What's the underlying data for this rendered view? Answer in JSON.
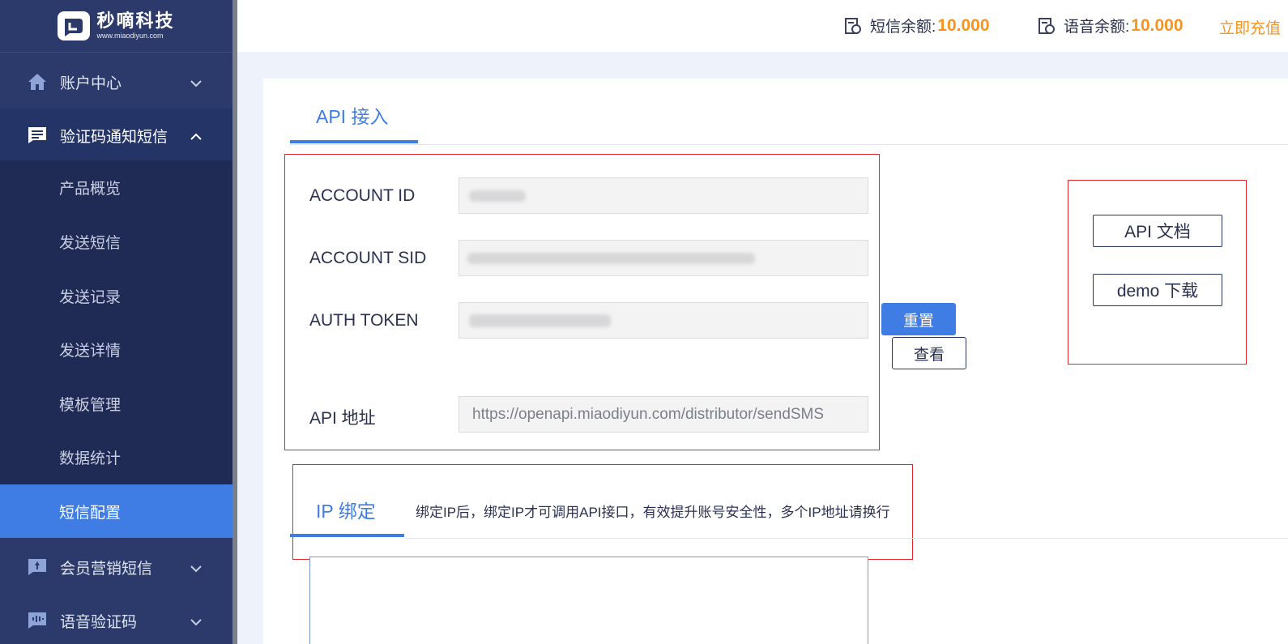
{
  "brand": {
    "name": "秒嘀科技",
    "url": "www.miaodiyun.com"
  },
  "sidebar": {
    "groups": [
      {
        "label": "账户中心",
        "icon": "home-icon"
      },
      {
        "label": "验证码通知短信",
        "icon": "message-icon"
      },
      {
        "label": "会员营销短信",
        "icon": "marketing-icon"
      },
      {
        "label": "语音验证码",
        "icon": "voice-icon"
      }
    ],
    "sub_items": [
      {
        "label": "产品概览"
      },
      {
        "label": "发送短信"
      },
      {
        "label": "发送记录"
      },
      {
        "label": "发送详情"
      },
      {
        "label": "模板管理"
      },
      {
        "label": "数据统计"
      },
      {
        "label": "短信配置",
        "active": true
      }
    ]
  },
  "header": {
    "sms_balance_label": "短信余额:",
    "sms_balance_value": "10.000",
    "voice_balance_label": "语音余额:",
    "voice_balance_value": "10.000",
    "recharge_label": "立即充值"
  },
  "api": {
    "tab_label": "API 接入",
    "account_id_label": "ACCOUNT ID",
    "account_sid_label": "ACCOUNT SID",
    "auth_token_label": "AUTH TOKEN",
    "api_url_label": "API 地址",
    "api_url_value": "https://openapi.miaodiyun.com/distributor/sendSMS",
    "reset_button": "重置",
    "view_button": "查看",
    "doc_button": "API 文档",
    "demo_button": "demo 下载"
  },
  "ip": {
    "tab_label": "IP 绑定",
    "description": "绑定IP后，绑定IP才可调用API接口，有效提升账号安全性，多个IP地址请换行"
  },
  "colors": {
    "accent": "#3f7de5",
    "balance": "#f7931e",
    "sidebar_bg": "#2b3a6b",
    "highlight_box": "#e8262f"
  }
}
